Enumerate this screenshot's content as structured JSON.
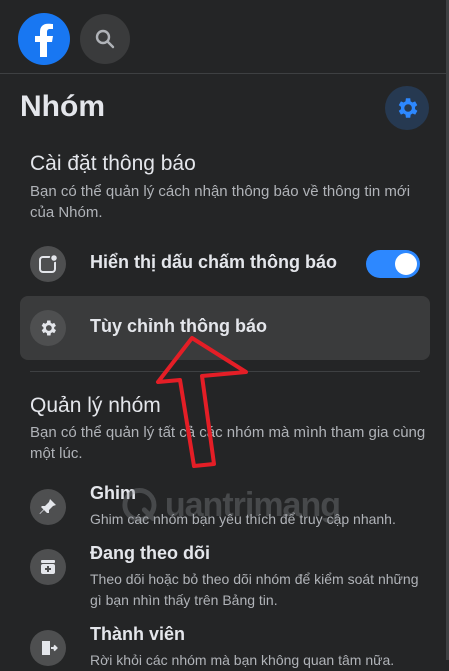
{
  "header": {
    "title": "Nhóm"
  },
  "notifications_section": {
    "title": "Cài đặt thông báo",
    "description": "Bạn có thể quản lý cách nhận thông báo về thông tin mới của Nhóm."
  },
  "rows": {
    "show_dot": {
      "label": "Hiển thị dấu chấm thông báo",
      "toggle_on": true
    },
    "customize": {
      "label": "Tùy chỉnh thông báo"
    }
  },
  "manage_section": {
    "title": "Quản lý nhóm",
    "description": "Bạn có thể quản lý tất cả các nhóm mà mình tham gia cùng một lúc."
  },
  "items": [
    {
      "title": "Ghim",
      "description": "Ghim các nhóm bạn yêu thích để truy cập nhanh.",
      "icon": "pin-icon"
    },
    {
      "title": "Đang theo dõi",
      "description": "Theo dõi hoặc bỏ theo dõi nhóm để kiểm soát những gì bạn nhìn thấy trên Bảng tin.",
      "icon": "following-icon"
    },
    {
      "title": "Thành viên",
      "description": "Rời khỏi các nhóm mà bạn không quan tâm nữa.",
      "icon": "leave-icon"
    }
  ],
  "watermark": {
    "text": "uantrimang"
  },
  "colors": {
    "accent": "#1877f2",
    "toggle": "#2d88ff",
    "background": "#242526",
    "annotation_arrow": "#e41e26"
  }
}
